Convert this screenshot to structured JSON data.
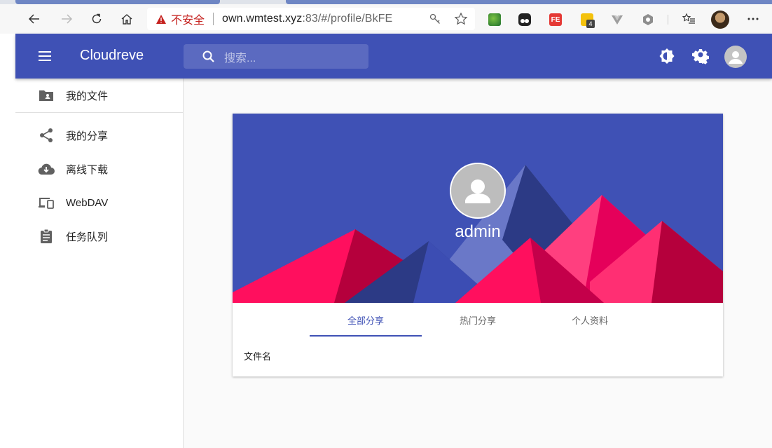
{
  "browser": {
    "security_label": "不安全",
    "url_host": "own.wmtest.xyz",
    "url_rest": ":83/#/profile/BkFE",
    "extension_badge": "4"
  },
  "appbar": {
    "brand": "Cloudreve",
    "search_placeholder": "搜索..."
  },
  "sidebar": {
    "items": [
      {
        "label": "我的文件",
        "icon": "folder-shared-icon"
      },
      {
        "label": "我的分享",
        "icon": "share-icon"
      },
      {
        "label": "离线下载",
        "icon": "cloud-download-icon"
      },
      {
        "label": "WebDAV",
        "icon": "devices-icon"
      },
      {
        "label": "任务队列",
        "icon": "assignment-icon"
      }
    ]
  },
  "profile": {
    "username": "admin",
    "tabs": [
      "全部分享",
      "热门分享",
      "个人资料"
    ],
    "active_tab": 0,
    "column_header": "文件名"
  },
  "colors": {
    "primary": "#3f51b5",
    "banner_pink": "#ff1f6e",
    "banner_dark_pink": "#b5003c",
    "banner_navy": "#2c3a85"
  }
}
